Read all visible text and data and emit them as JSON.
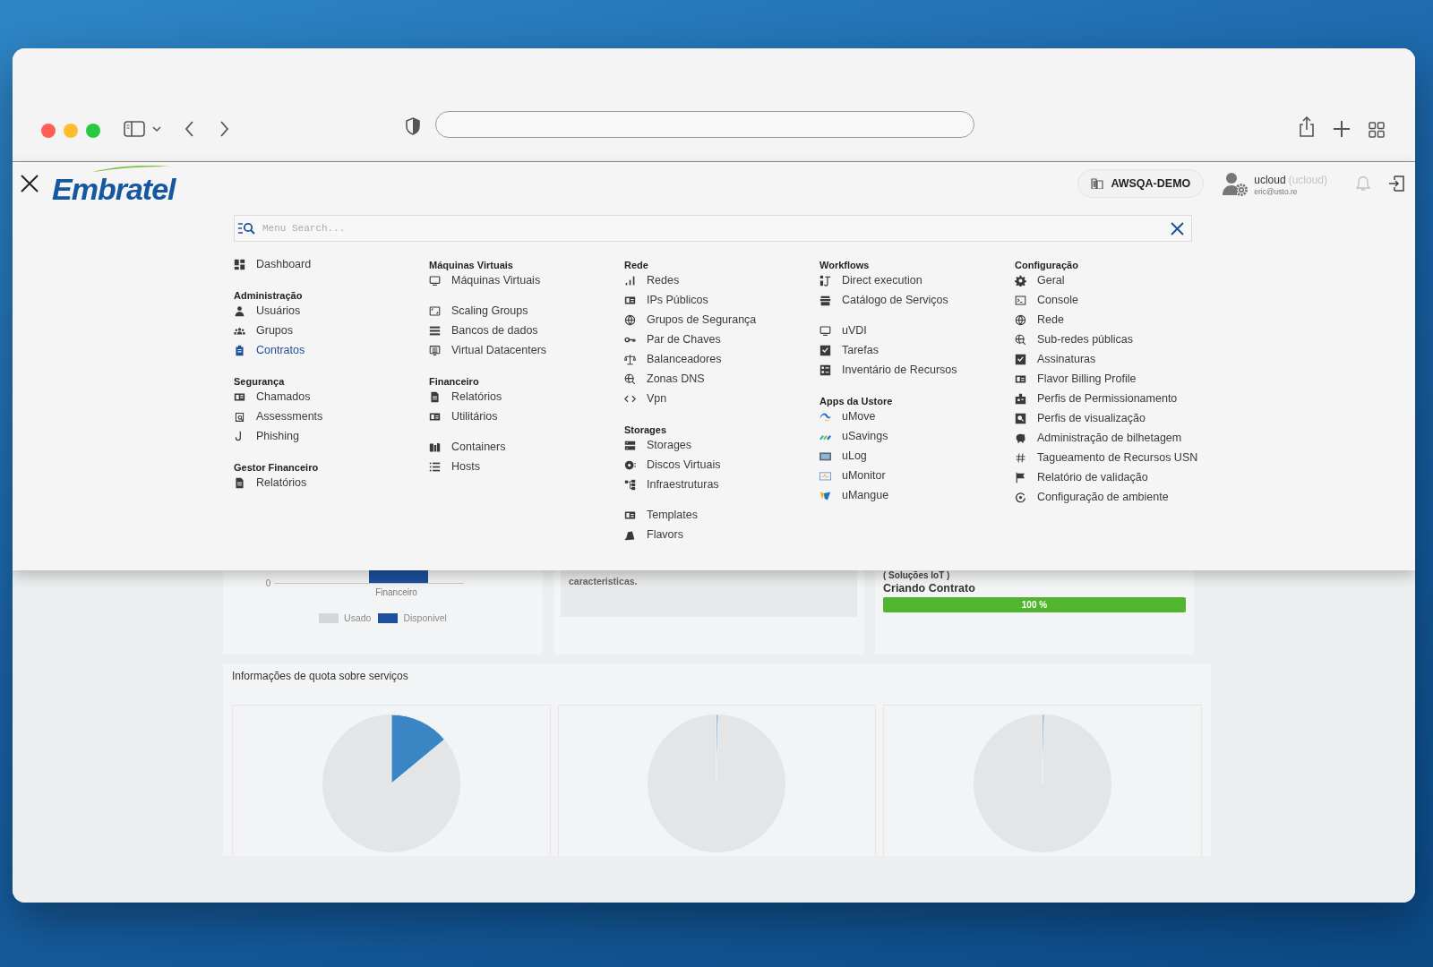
{
  "header": {
    "logo": "Embratel",
    "tenant": "AWSQA-DEMO",
    "user_name": "ucloud",
    "user_login": "(ucloud)",
    "user_email": "eric@usto.re"
  },
  "menu": {
    "search_placeholder": "Menu Search...",
    "columns": [
      {
        "groups": [
          {
            "items": [
              {
                "label": "Dashboard",
                "selected": false
              }
            ]
          },
          {
            "title": "Administração",
            "items": [
              {
                "label": "Usuários",
                "selected": false
              },
              {
                "label": "Grupos",
                "selected": false
              },
              {
                "label": "Contratos",
                "selected": true
              }
            ]
          },
          {
            "title": "Segurança",
            "items": [
              {
                "label": "Chamados",
                "selected": false
              },
              {
                "label": "Assessments",
                "selected": false
              },
              {
                "label": "Phishing",
                "selected": false
              }
            ]
          },
          {
            "title": "Gestor Financeiro",
            "items": [
              {
                "label": "Relatórios",
                "selected": false
              }
            ]
          }
        ]
      },
      {
        "groups": [
          {
            "title": "Máquinas Virtuais",
            "items": [
              {
                "label": "Máquinas Virtuais",
                "selected": false
              }
            ]
          },
          {
            "items": [
              {
                "label": "Scaling Groups",
                "selected": false
              },
              {
                "label": "Bancos de dados",
                "selected": false
              },
              {
                "label": "Virtual Datacenters",
                "selected": false
              }
            ]
          },
          {
            "title": "Financeiro",
            "items": [
              {
                "label": "Relatórios",
                "selected": false
              },
              {
                "label": "Utilitários",
                "selected": false
              }
            ]
          },
          {
            "items": [
              {
                "label": "Containers",
                "selected": false
              },
              {
                "label": "Hosts",
                "selected": false
              }
            ]
          }
        ]
      },
      {
        "groups": [
          {
            "title": "Rede",
            "items": [
              {
                "label": "Redes",
                "selected": false
              },
              {
                "label": "IPs Públicos",
                "selected": false
              },
              {
                "label": "Grupos de Segurança",
                "selected": false
              },
              {
                "label": "Par de Chaves",
                "selected": false
              },
              {
                "label": "Balanceadores",
                "selected": false
              },
              {
                "label": "Zonas DNS",
                "selected": false
              },
              {
                "label": "Vpn",
                "selected": false
              }
            ]
          },
          {
            "title": "Storages",
            "items": [
              {
                "label": "Storages",
                "selected": false
              },
              {
                "label": "Discos Virtuais",
                "selected": false
              },
              {
                "label": "Infraestruturas",
                "selected": false
              }
            ]
          },
          {
            "items": [
              {
                "label": "Templates",
                "selected": false
              },
              {
                "label": "Flavors",
                "selected": false
              }
            ]
          }
        ]
      },
      {
        "groups": [
          {
            "title": "Workflows",
            "items": [
              {
                "label": "Direct execution",
                "selected": false
              },
              {
                "label": "Catálogo de Serviços",
                "selected": false
              }
            ]
          },
          {
            "items": [
              {
                "label": "uVDI",
                "selected": false
              },
              {
                "label": "Tarefas",
                "selected": false
              },
              {
                "label": "Inventário de Recursos",
                "selected": false
              }
            ]
          },
          {
            "title": "Apps da Ustore",
            "items": [
              {
                "label": "uMove",
                "selected": false
              },
              {
                "label": "uSavings",
                "selected": false
              },
              {
                "label": "uLog",
                "selected": false
              },
              {
                "label": "uMonitor",
                "selected": false
              },
              {
                "label": "uMangue",
                "selected": false
              }
            ]
          }
        ]
      },
      {
        "groups": [
          {
            "title": "Configuração",
            "items": [
              {
                "label": "Geral",
                "selected": false
              },
              {
                "label": "Console",
                "selected": false
              },
              {
                "label": "Rede",
                "selected": false
              },
              {
                "label": "Sub-redes públicas",
                "selected": false
              },
              {
                "label": "Assinaturas",
                "selected": false
              },
              {
                "label": "Flavor Billing Profile",
                "selected": false
              },
              {
                "label": "Perfis de Permissionamento",
                "selected": false
              },
              {
                "label": "Perfis de visualização",
                "selected": false
              },
              {
                "label": "Administração de bilhetagem",
                "selected": false
              },
              {
                "label": "Tagueamento de Recursos USN",
                "selected": false
              },
              {
                "label": "Relatório de validação",
                "selected": false
              },
              {
                "label": "Configuração de ambiente",
                "selected": false
              }
            ]
          }
        ]
      }
    ]
  },
  "dashboard": {
    "usage_chart": {
      "tick": "0",
      "category": "Financeiro",
      "legend": [
        {
          "label": "Usado",
          "color": "#d3d7d9"
        },
        {
          "label": "Disponivel",
          "color": "#1c4f9c"
        }
      ]
    },
    "info_text": "caracteristicas.",
    "contract": {
      "tag": "( Soluções IoT )",
      "status": "Criando Contrato",
      "level": 1,
      "reading": "100 %"
    },
    "quota": {
      "title": "Informações de quota sobre serviços"
    }
  }
}
